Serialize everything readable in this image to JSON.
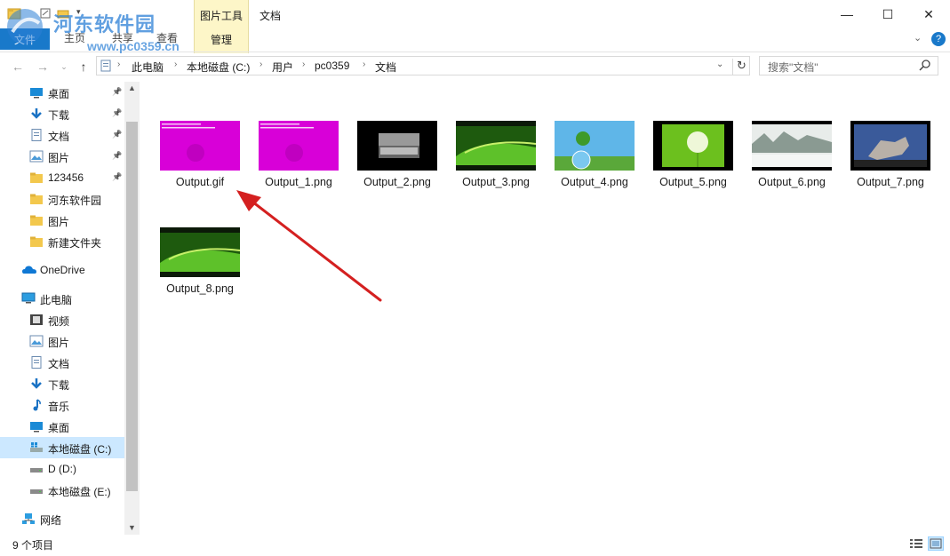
{
  "window": {
    "title": "文档",
    "context_group": "图片工具",
    "min": "—",
    "max": "☐",
    "close": "✕"
  },
  "ribbon": {
    "file_tab": "文件",
    "tabs": [
      "主页",
      "共享",
      "查看"
    ],
    "manage": "管理"
  },
  "watermark": {
    "name": "河东软件园",
    "url": "www.pc0359.cn"
  },
  "address": {
    "crumbs": [
      "此电脑",
      "本地磁盘 (C:)",
      "用户",
      "pc0359",
      "文档"
    ]
  },
  "search": {
    "placeholder": "搜索\"文档\""
  },
  "sidebar": {
    "quick": [
      {
        "label": "桌面",
        "icon": "desktop-icon",
        "pinned": true
      },
      {
        "label": "下载",
        "icon": "download-icon",
        "pinned": true
      },
      {
        "label": "文档",
        "icon": "document-icon",
        "pinned": true
      },
      {
        "label": "图片",
        "icon": "pictures-icon",
        "pinned": true
      },
      {
        "label": "123456",
        "icon": "folder-icon",
        "pinned": true
      },
      {
        "label": "河东软件园",
        "icon": "folder-icon",
        "pinned": false
      },
      {
        "label": "图片",
        "icon": "folder-icon",
        "pinned": false
      },
      {
        "label": "新建文件夹",
        "icon": "folder-icon",
        "pinned": false
      }
    ],
    "onedrive": "OneDrive",
    "thispc": "此电脑",
    "pc_items": [
      {
        "label": "视频",
        "icon": "video-icon"
      },
      {
        "label": "图片",
        "icon": "pictures-icon"
      },
      {
        "label": "文档",
        "icon": "document-icon"
      },
      {
        "label": "下载",
        "icon": "download-icon"
      },
      {
        "label": "音乐",
        "icon": "music-icon"
      },
      {
        "label": "桌面",
        "icon": "desktop-icon"
      },
      {
        "label": "本地磁盘 (C:)",
        "icon": "drive-c-icon",
        "selected": true
      },
      {
        "label": "D (D:)",
        "icon": "drive-icon"
      },
      {
        "label": "本地磁盘 (E:)",
        "icon": "drive-icon"
      }
    ],
    "network": "网络"
  },
  "files": [
    {
      "name": "Output.gif",
      "thumb": "magenta-text"
    },
    {
      "name": "Output_1.png",
      "thumb": "magenta-text"
    },
    {
      "name": "Output_2.png",
      "thumb": "dark-city"
    },
    {
      "name": "Output_3.png",
      "thumb": "green-wave"
    },
    {
      "name": "Output_4.png",
      "thumb": "sky-globe"
    },
    {
      "name": "Output_5.png",
      "thumb": "dandelion"
    },
    {
      "name": "Output_6.png",
      "thumb": "ink-landscape"
    },
    {
      "name": "Output_7.png",
      "thumb": "wolf"
    },
    {
      "name": "Output_8.png",
      "thumb": "green-wave"
    }
  ],
  "status": {
    "count": "9 个项目"
  },
  "annotation": {
    "arrow_color": "#d42020"
  }
}
